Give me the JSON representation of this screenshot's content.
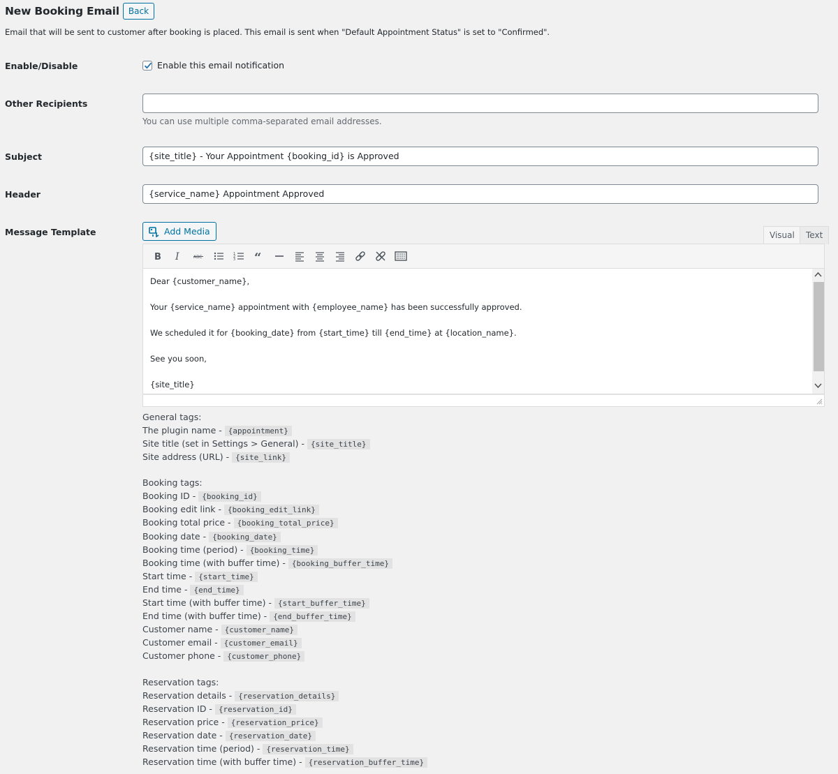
{
  "page": {
    "title": "New Booking Email",
    "back_label": "Back",
    "intro": "Email that will be sent to customer after booking is placed. This email is sent when \"Default Appointment Status\" is set to \"Confirmed\"."
  },
  "fields": {
    "enable_label": "Enable/Disable",
    "enable_checkbox_label": "Enable this email notification",
    "enable_checked": true,
    "recipients_label": "Other Recipients",
    "recipients_value": "",
    "recipients_desc": "You can use multiple comma-separated email addresses.",
    "subject_label": "Subject",
    "subject_value": "{site_title} - Your Appointment {booking_id} is Approved",
    "header_label": "Header",
    "header_value": "{service_name} Appointment Approved",
    "message_label": "Message Template"
  },
  "editor": {
    "add_media_label": "Add Media",
    "tab_visual": "Visual",
    "tab_text": "Text",
    "active_tab": "Visual",
    "toolbar_icons": [
      "bold-icon",
      "italic-icon",
      "strikethrough-icon",
      "bullet-list-icon",
      "numbered-list-icon",
      "blockquote-icon",
      "horizontal-line-icon",
      "align-left-icon",
      "align-center-icon",
      "align-right-icon",
      "insert-link-icon",
      "remove-link-icon",
      "toolbar-toggle-icon"
    ],
    "lines": [
      "Dear {customer_name},",
      "Your {service_name} appointment with {employee_name} has been successfully approved.",
      "We scheduled it for {booking_date} from {start_time} till {end_time} at {location_name}.",
      "See you soon,",
      "{site_title}"
    ]
  },
  "tags": {
    "general_heading": "General tags:",
    "general": [
      {
        "label": "The plugin name -",
        "tag": "{appointment}"
      },
      {
        "label": "Site title (set in Settings > General) -",
        "tag": "{site_title}"
      },
      {
        "label": "Site address (URL) -",
        "tag": "{site_link}"
      }
    ],
    "booking_heading": "Booking tags:",
    "booking": [
      {
        "label": "Booking ID -",
        "tag": "{booking_id}"
      },
      {
        "label": "Booking edit link -",
        "tag": "{booking_edit_link}"
      },
      {
        "label": "Booking total price -",
        "tag": "{booking_total_price}"
      },
      {
        "label": "Booking date -",
        "tag": "{booking_date}"
      },
      {
        "label": "Booking time (period) -",
        "tag": "{booking_time}"
      },
      {
        "label": "Booking time (with buffer time) -",
        "tag": "{booking_buffer_time}"
      },
      {
        "label": "Start time -",
        "tag": "{start_time}"
      },
      {
        "label": "End time -",
        "tag": "{end_time}"
      },
      {
        "label": "Start time (with buffer time) -",
        "tag": "{start_buffer_time}"
      },
      {
        "label": "End time (with buffer time) -",
        "tag": "{end_buffer_time}"
      },
      {
        "label": "Customer name -",
        "tag": "{customer_name}"
      },
      {
        "label": "Customer email -",
        "tag": "{customer_email}"
      },
      {
        "label": "Customer phone -",
        "tag": "{customer_phone}"
      }
    ],
    "reservation_heading": "Reservation tags:",
    "reservation": [
      {
        "label": "Reservation details -",
        "tag": "{reservation_details}"
      },
      {
        "label": "Reservation ID -",
        "tag": "{reservation_id}"
      },
      {
        "label": "Reservation price -",
        "tag": "{reservation_price}"
      },
      {
        "label": "Reservation date -",
        "tag": "{reservation_date}"
      },
      {
        "label": "Reservation time (period) -",
        "tag": "{reservation_time}"
      },
      {
        "label": "Reservation time (with buffer time) -",
        "tag": "{reservation_buffer_time}"
      }
    ]
  },
  "colors": {
    "accent": "#0071a1",
    "background": "#f1f1f1",
    "tag_bg": "#e2e2e2"
  }
}
